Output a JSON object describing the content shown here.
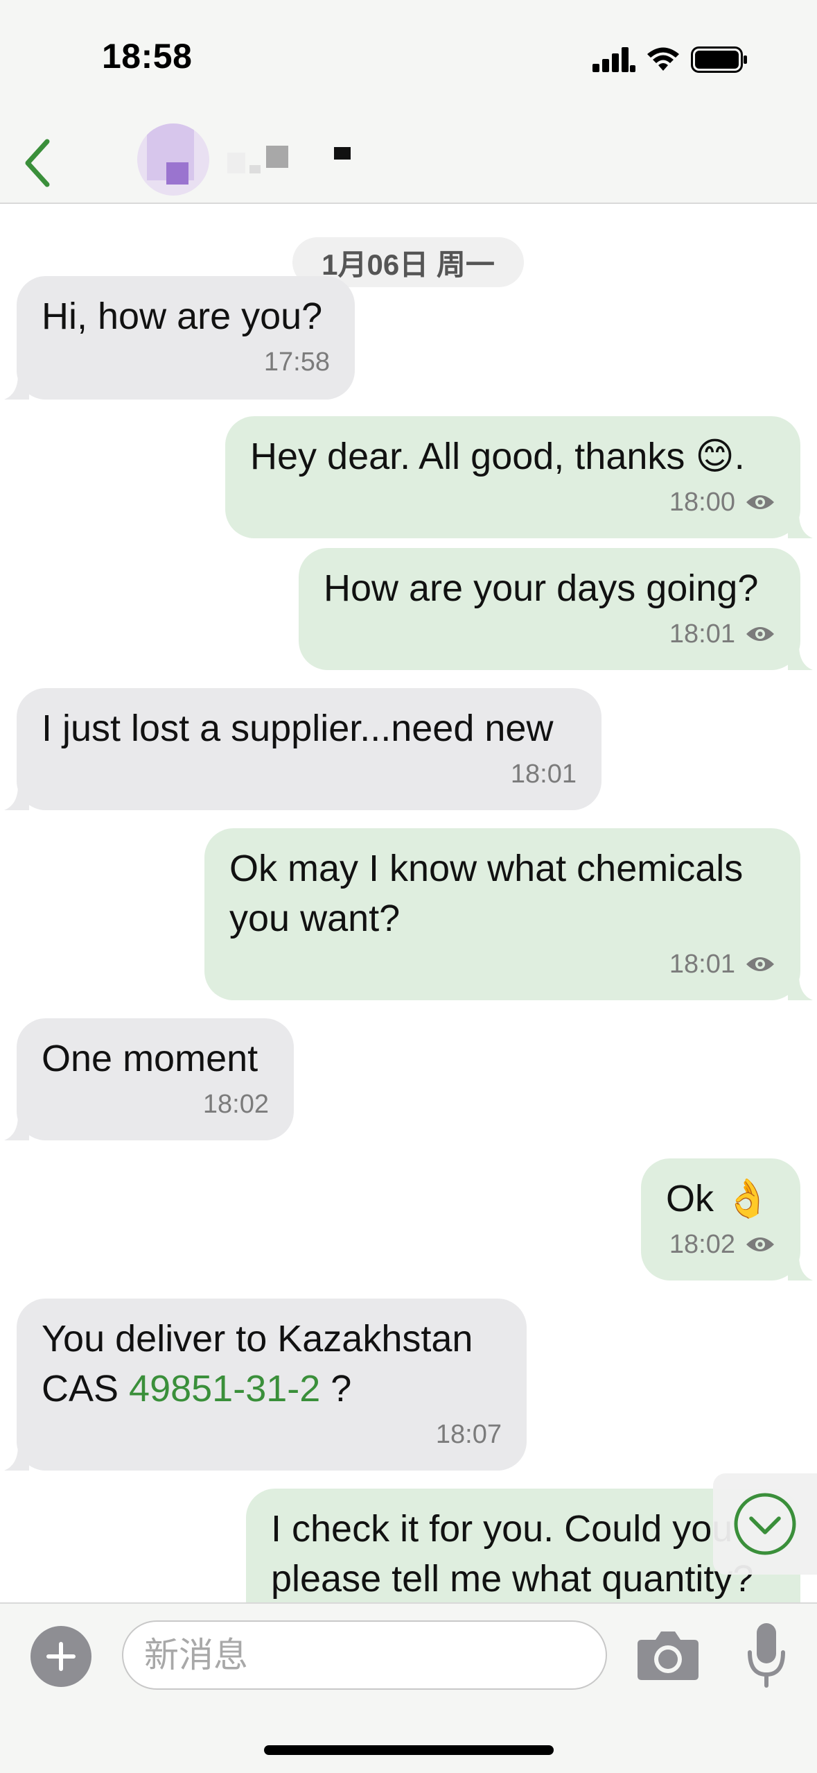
{
  "status_bar": {
    "time": "18:58"
  },
  "chat": {
    "date_separator": "1月06日 周一",
    "messages": [
      {
        "direction": "in",
        "text": "Hi, how are you?",
        "time": "17:58"
      },
      {
        "direction": "out",
        "text": "Hey dear. All good, thanks 😊.",
        "time": "18:00",
        "read_icon": "eye-icon"
      },
      {
        "direction": "out",
        "text": "How are your days going?",
        "time": "18:01",
        "read_icon": "eye-icon"
      },
      {
        "direction": "in",
        "text": "I just lost a supplier...need new",
        "time": "18:01"
      },
      {
        "direction": "out",
        "text": "Ok may I know what chemicals you want?",
        "time": "18:01",
        "read_icon": "eye-icon"
      },
      {
        "direction": "in",
        "text": "One moment",
        "time": "18:02"
      },
      {
        "direction": "out",
        "text": "Ok 👌",
        "time": "18:02",
        "read_icon": "eye-icon"
      },
      {
        "direction": "in",
        "text_before": "You deliver to Kazakhstan\nCAS ",
        "link": "49851-31-2",
        "text_after": " ?",
        "time": "18:07"
      },
      {
        "direction": "out",
        "text": "I check it for you. Could you please tell me what quantity?"
      }
    ]
  },
  "input": {
    "placeholder": "新消息"
  },
  "colors": {
    "accent": "#3a8f3a",
    "incoming_bubble": "#e9e9eb",
    "outgoing_bubble": "#dfeedf"
  },
  "icons": {
    "back": "chevron-left-icon",
    "plus": "plus-icon",
    "camera": "camera-icon",
    "mic": "microphone-icon",
    "scroll_down": "chevron-down-circle-icon"
  }
}
